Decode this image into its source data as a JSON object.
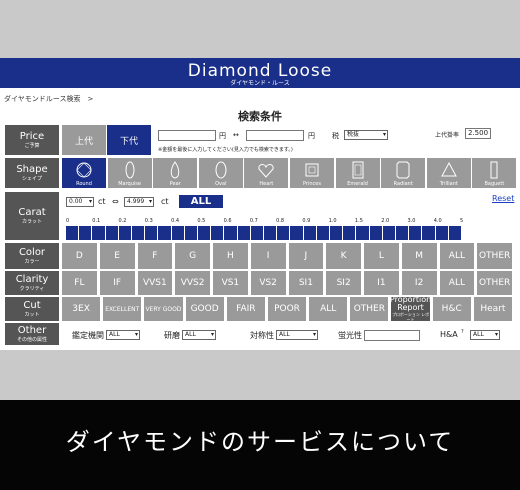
{
  "header": {
    "title": "Diamond  Loose",
    "subtitle": "ダイヤモンド・ルース"
  },
  "breadcrumb": "ダイヤモンドルース検索　>",
  "page_title": "検索条件",
  "price": {
    "label": "Price",
    "label_jp": "ご予算",
    "tabs": [
      "上代",
      "下代"
    ],
    "yen": "円",
    "range": "↔",
    "tax_label": "税",
    "tax_value": "税抜",
    "multiplier_label": "上代掛率",
    "multiplier_value": "2.500",
    "note": "※金額を最後に入力してください(見入力でも検索できます。)"
  },
  "shape": {
    "label": "Shape",
    "label_jp": "シェイプ",
    "options": [
      "Round",
      "Marquise",
      "Pear",
      "Oval",
      "Heart",
      "Princes",
      "Emerald",
      "Radiant",
      "Trilliant",
      "Baguett"
    ]
  },
  "carat": {
    "label": "Carat",
    "label_jp": "カラット",
    "from": "0.00",
    "to": "4.999",
    "unit": "ct",
    "range": "⇔",
    "all": "ALL",
    "reset": "Reset",
    "ticks": [
      "0",
      "0.1",
      "0.2",
      "0.3",
      "0.4",
      "0.5",
      "0.6",
      "0.7",
      "0.8",
      "0.9",
      "1.0",
      "1.5",
      "2.0",
      "3.0",
      "4.0",
      "5"
    ]
  },
  "color": {
    "label": "Color",
    "label_jp": "カラー",
    "options": [
      "D",
      "E",
      "F",
      "G",
      "H",
      "I",
      "J",
      "K",
      "L",
      "M",
      "ALL",
      "OTHER"
    ]
  },
  "clarity": {
    "label": "Clarity",
    "label_jp": "クラリティ",
    "options": [
      "FL",
      "IF",
      "VVS1",
      "VVS2",
      "VS1",
      "VS2",
      "SI1",
      "SI2",
      "I1",
      "I2",
      "ALL",
      "OTHER"
    ]
  },
  "cut": {
    "label": "Cut",
    "label_jp": "カット",
    "options": [
      "3EX",
      "EXCELLENT",
      "VERY GOOD",
      "GOOD",
      "FAIR",
      "POOR",
      "ALL",
      "OTHER",
      "Proportion Report",
      "H&C",
      "Heart"
    ],
    "proportion_sub": "プロポーション レポート"
  },
  "other": {
    "label": "Other",
    "label_jp": "その他の属性",
    "fields": [
      {
        "label": "鑑定機関",
        "value": "ALL"
      },
      {
        "label": "研磨",
        "value": "ALL"
      },
      {
        "label": "対称性",
        "value": "ALL"
      },
      {
        "label": "蛍光性",
        "value": ""
      },
      {
        "label": "H&A",
        "value": "ALL"
      }
    ]
  },
  "footer": "ダイヤモンドのサービスについて"
}
